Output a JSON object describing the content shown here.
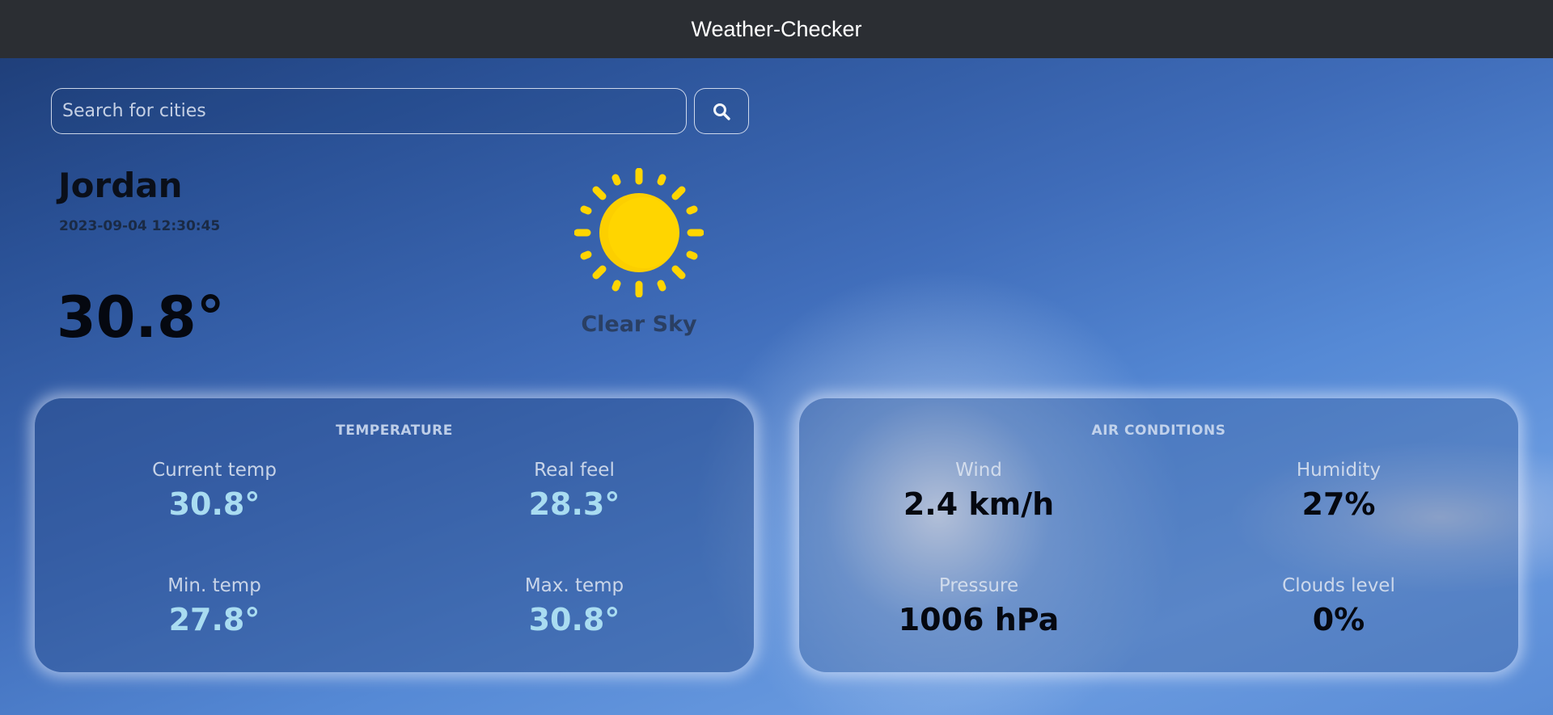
{
  "app": {
    "title": "Weather-Checker"
  },
  "search": {
    "placeholder": "Search for cities",
    "value": "",
    "button_icon": "search-icon"
  },
  "location": {
    "city": "Jordan",
    "datetime": "2023-09-04 12:30:45",
    "temperature": "30.8°",
    "condition": "Clear Sky",
    "condition_icon": "sun-icon"
  },
  "temperature_card": {
    "title": "TEMPERATURE",
    "stats": [
      {
        "label": "Current temp",
        "value": "30.8°"
      },
      {
        "label": "Real feel",
        "value": "28.3°"
      },
      {
        "label": "Min. temp",
        "value": "27.8°"
      },
      {
        "label": "Max. temp",
        "value": "30.8°"
      }
    ]
  },
  "air_card": {
    "title": "AIR CONDITIONS",
    "stats": [
      {
        "label": "Wind",
        "value": "2.4 km/h"
      },
      {
        "label": "Humidity",
        "value": "27%"
      },
      {
        "label": "Pressure",
        "value": "1006 hPa"
      },
      {
        "label": "Clouds level",
        "value": "0%"
      }
    ]
  },
  "colors": {
    "topbar": "#2b2e33",
    "sun": "#ffd500",
    "temp_value": "#a9dcf1"
  }
}
